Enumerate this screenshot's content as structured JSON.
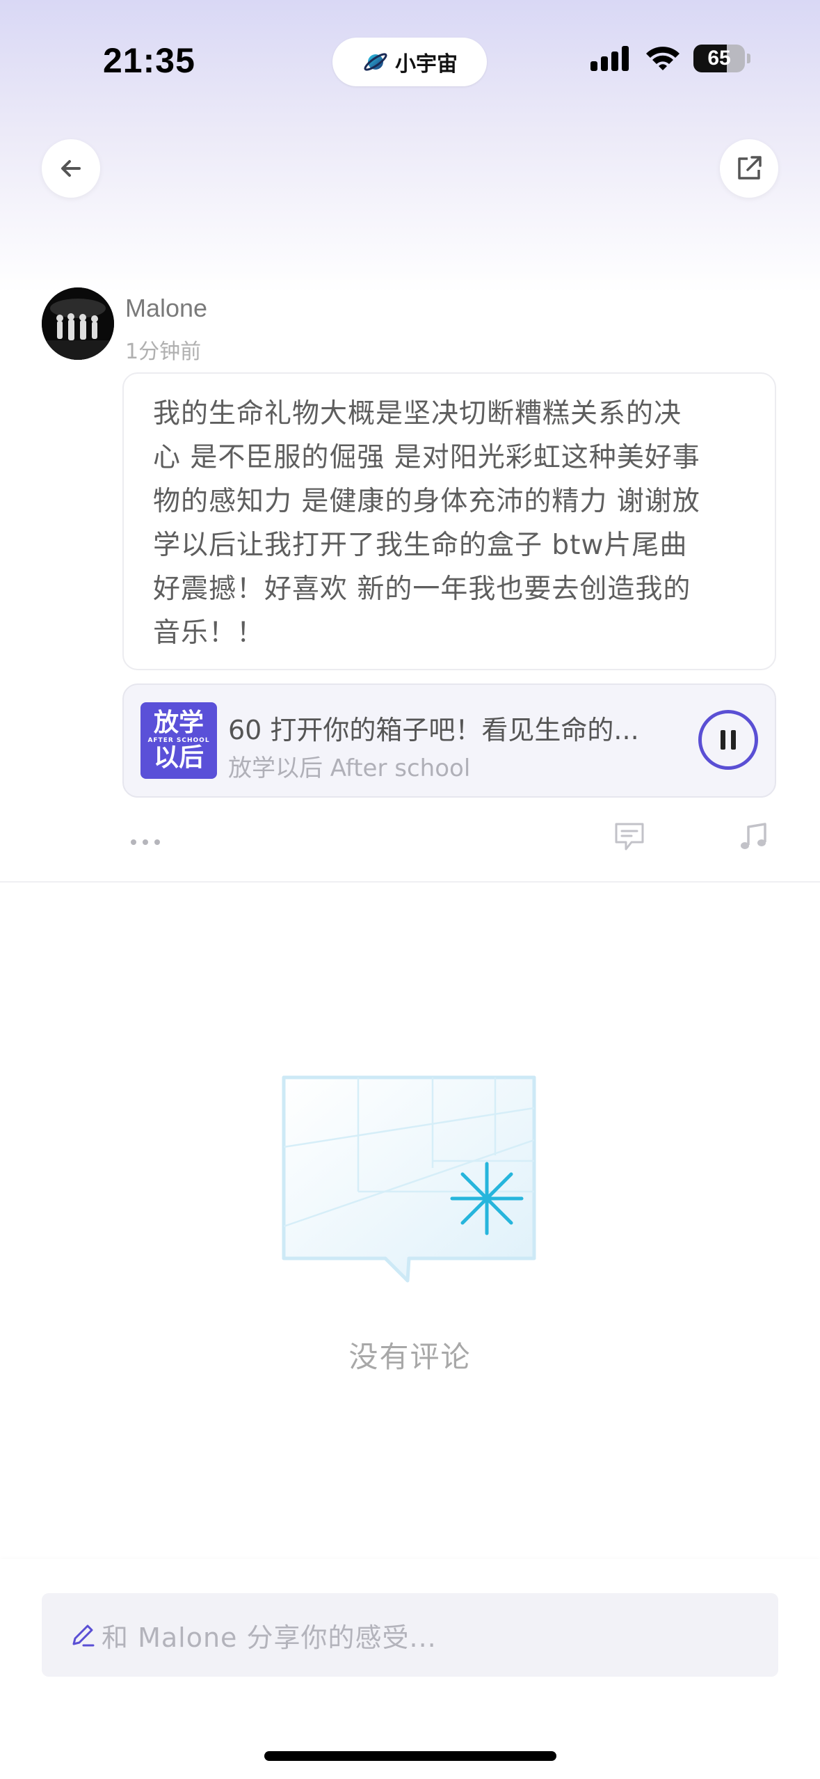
{
  "status_bar": {
    "time": "21:35",
    "app_label": "小宇宙",
    "battery_percent": "65",
    "battery_level": 0.65
  },
  "header": {
    "back_icon": "arrow-left-icon",
    "share_icon": "share-external-icon"
  },
  "post": {
    "author_name": "Malone",
    "time_ago": "1分钟前",
    "text_lines": [
      "我的生命礼物大概是坚决切断糟糕关系的决",
      "心 是不臣服的倔强 是对阳光彩虹这种美好事",
      "物的感知力 是健康的身体充沛的精力 谢谢放",
      "学以后让我打开了我生命的盒子 btw片尾曲",
      "好震撼！好喜欢 新的一年我也要去创造我的",
      "音乐！！"
    ]
  },
  "track": {
    "cover_line1": "放学",
    "cover_line2": "AFTER SCHOOL",
    "cover_line3": "以后",
    "title": "60 打开你的箱子吧！看见生命的...",
    "artist": "放学以后 After school",
    "state": "playing",
    "accent_color": "#5a4fd4"
  },
  "actions": {
    "more_icon": "more-dots-icon",
    "comment_icon": "comment-icon",
    "music_icon": "music-note-icon"
  },
  "comments": {
    "empty_text": "没有评论"
  },
  "composer": {
    "placeholder": "和 Malone 分享你的感受..."
  }
}
